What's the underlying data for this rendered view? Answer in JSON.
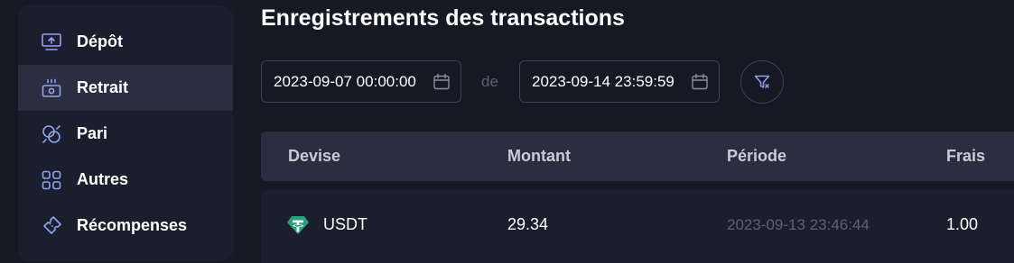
{
  "sidebar": {
    "items": [
      {
        "label": "Dépôt",
        "icon": "deposit-icon"
      },
      {
        "label": "Retrait",
        "icon": "withdraw-icon",
        "active": true
      },
      {
        "label": "Pari",
        "icon": "bet-icon"
      },
      {
        "label": "Autres",
        "icon": "grid-icon"
      },
      {
        "label": "Récompenses",
        "icon": "ticket-icon"
      }
    ]
  },
  "header": {
    "title": "Enregistrements des transactions"
  },
  "filters": {
    "start_date": "2023-09-07 00:00:00",
    "separator": "de",
    "end_date": "2023-09-14 23:59:59"
  },
  "table": {
    "columns": [
      "Devise",
      "Montant",
      "Période",
      "Frais"
    ],
    "rows": [
      {
        "currency": "USDT",
        "amount": "29.34",
        "period": "2023-09-13 23:46:44",
        "fee": "1.00"
      }
    ]
  },
  "colors": {
    "accent_icon": "#7f9cf5",
    "usdt_green": "#26a17b",
    "active_bg": "#2a2e40"
  }
}
